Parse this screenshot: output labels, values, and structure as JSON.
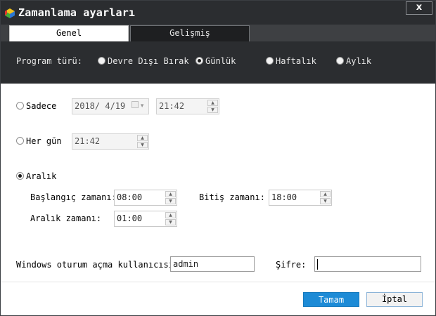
{
  "window": {
    "title": "Zamanlama ayarları",
    "close_label": "x"
  },
  "tabs": [
    {
      "label": "Genel",
      "active": true
    },
    {
      "label": "Gelişmiş",
      "active": false
    }
  ],
  "program_type": {
    "label": "Program türü:",
    "options": [
      {
        "label": "Devre Dışı Bırak",
        "checked": false
      },
      {
        "label": "Günlük",
        "checked": true
      },
      {
        "label": "Haftalık",
        "checked": false
      },
      {
        "label": "Aylık",
        "checked": false
      }
    ]
  },
  "once": {
    "label": "Sadece",
    "date": "2018/ 4/19",
    "time": "21:42"
  },
  "daily": {
    "label": "Her gün",
    "time": "21:42"
  },
  "interval": {
    "label": "Aralık",
    "start_label": "Başlangıç zamanı:",
    "start_time": "08:00",
    "end_label": "Bitiş zamanı:",
    "end_time": "18:00",
    "interval_label": "Aralık zamanı:",
    "interval_time": "01:00"
  },
  "credentials": {
    "user_label": "Windows oturum açma kullanıcısı:",
    "user_value": "admin",
    "password_label": "Şifre:",
    "password_value": ""
  },
  "buttons": {
    "ok": "Tamam",
    "cancel": "İptal"
  },
  "colors": {
    "dark_bg": "#2b2d30",
    "accent": "#1d8bd6"
  }
}
